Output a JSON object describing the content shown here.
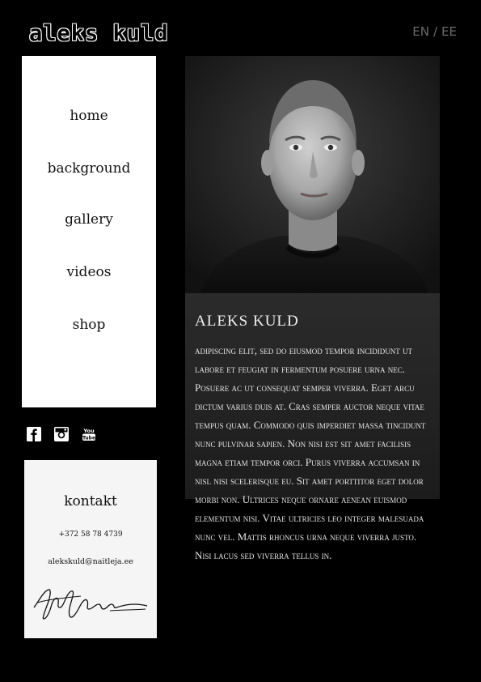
{
  "header": {
    "logo_text": "aleks kuld",
    "lang_en": "EN",
    "lang_sep": "/",
    "lang_ee": "EE"
  },
  "nav": {
    "items": [
      {
        "label": "home"
      },
      {
        "label": "background"
      },
      {
        "label": "gallery"
      },
      {
        "label": "videos"
      },
      {
        "label": "shop"
      }
    ]
  },
  "social": {
    "icons": [
      "facebook-icon",
      "instagram-icon",
      "youtube-icon"
    ]
  },
  "contact": {
    "title": "kontakt",
    "phone": "+372 58 78 4739",
    "email": "alekskuld@naitleja.ee"
  },
  "bio": {
    "name": "ALEKS KULD",
    "text": "adipiscing elit, sed do eiusmod tempor incididunt ut labore et feugiat in fermentum posuere urna nec. Posuere ac ut consequat semper viverra. Eget arcu dictum varius duis at. Cras semper auctor neque vitae tempus quam. Commodo quis imperdiet massa tincidunt nunc pulvinar sapien. Non nisi est sit amet facilisis magna etiam tempor orci. Purus viverra accumsan in nisl nisi scelerisque eu. Sit amet porttitor eget dolor morbi non. Ultrices neque ornare aenean euismod elementum nisi. Vitae ultricies leo integer malesuada nunc vel. Mattis rhoncus urna neque viverra justo. Nisi lacus sed viverra tellus in."
  },
  "colors": {
    "background": "#000000",
    "panel": "#ffffff",
    "lang": "#6a6a6a"
  }
}
